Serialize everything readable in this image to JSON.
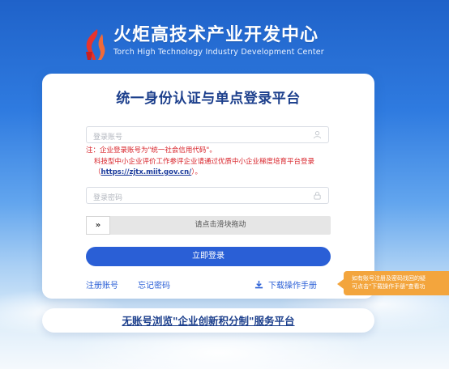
{
  "header": {
    "title_cn": "火炬高技术产业开发中心",
    "title_en": "Torch High Technology Industry Development Center",
    "logo_icon": "torch-flame-logo",
    "logo_color": "#e8342c"
  },
  "login": {
    "title": "统一身份认证与单点登录平台",
    "account": {
      "placeholder": "登录账号",
      "value": "",
      "icon": "user-icon"
    },
    "note_line1": "注：企业登录账号为\"统一社会信用代码\"。",
    "note_line2_prefix": "科技型中小企业评价工作参评企业请通过优质中小企业梯度培育平台登录（",
    "note_link": "https://zjtx.miit.gov.cn/",
    "note_line2_suffix": "）。",
    "password": {
      "placeholder": "登录密码",
      "value": "",
      "icon": "lock-icon"
    },
    "slider": {
      "handle": "»",
      "text": "请点击滑块拖动"
    },
    "login_button": "立即登录",
    "register_link": "注册账号",
    "forgot_link": "忘记密码",
    "download_link": "下载操作手册",
    "download_icon": "download-icon"
  },
  "tooltip": {
    "line1": "如有账号注册及密码找回的疑",
    "line2": "可点击\"下载操作手册\"查看功"
  },
  "guest": {
    "link": "无账号浏览\"企业创新积分制\"服务平台"
  },
  "colors": {
    "brand_blue": "#2a5fd6",
    "title_navy": "#1c3f8c",
    "note_red": "#d8232a",
    "tooltip_orange": "#f3a53d"
  }
}
